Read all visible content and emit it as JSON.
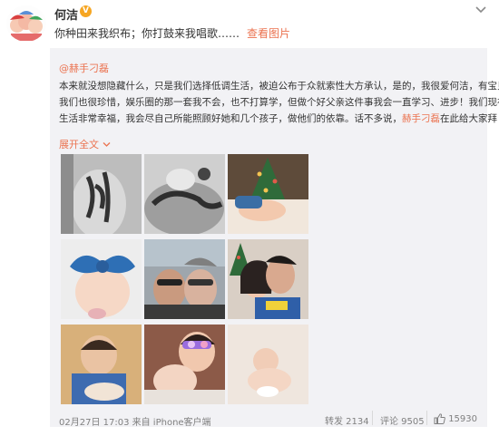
{
  "user": {
    "name": "何洁",
    "verified_badge": "V"
  },
  "post": {
    "text": "你种田来我织布；你打鼓来我唱歌……",
    "link": "查看图片"
  },
  "repost": {
    "author": "@赫手刁磊",
    "lines": [
      "本来就没想隐藏什么，只是我们选择低调生活，被迫公布于众就索性大方承认，是的，我很爱何洁，有宝贝",
      "我们也很珍惜，娱乐圈的那一套我不会，也不打算学，但做个好父亲这件事我会一直学习、进步！我们现在",
      "生活非常幸福，我会尽自己所能照顾好她和几个孩子，做他们的依靠。话不多说，"
    ],
    "mention": "赫手刁磊",
    "line3_tail": "在此给大家拜",
    "expand": "展开全文",
    "photo_count": 9,
    "footer": {
      "time": "02月27日 17:03 来自 iPhone客户端",
      "repost_label": "转发 2134",
      "comment_label": "评论 9505",
      "like_count": "15930"
    }
  },
  "colors": {
    "accent": "#eb7350",
    "repost_bg": "#f2f2f5",
    "badge": "#f6a623",
    "muted": "#808080"
  }
}
